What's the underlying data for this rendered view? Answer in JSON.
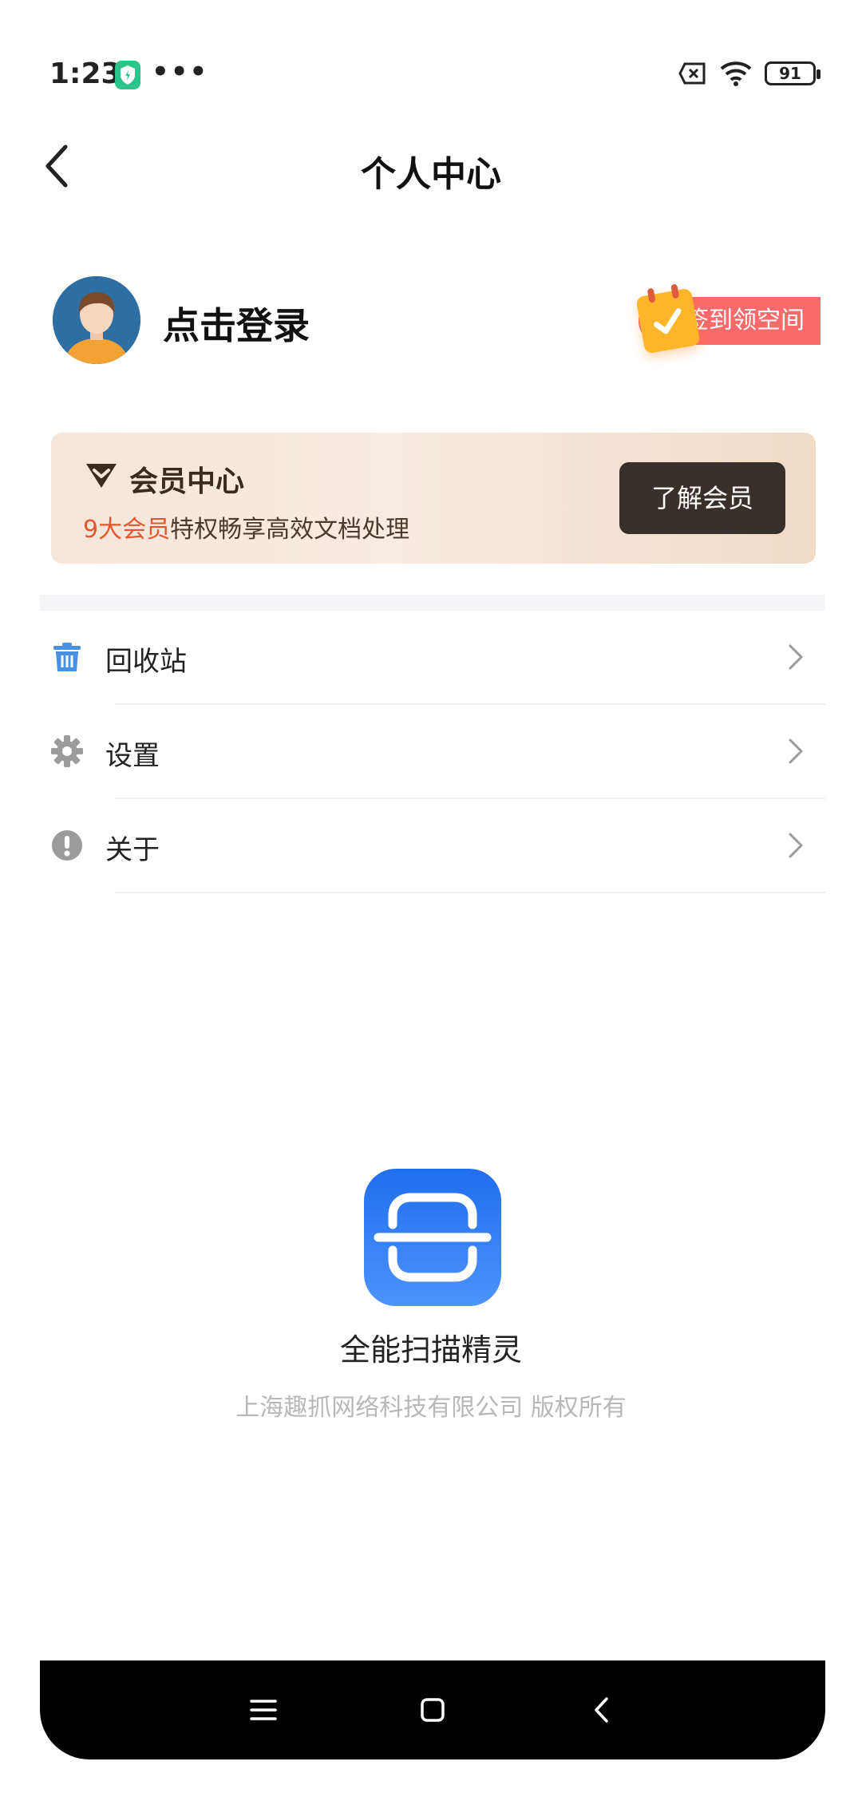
{
  "status_bar": {
    "time": "1:23",
    "dots": "•••",
    "battery": "91"
  },
  "header": {
    "title": "个人中心"
  },
  "profile": {
    "login_text": "点击登录",
    "checkin_label": "签到领空间"
  },
  "vip": {
    "title": "会员中心",
    "subtitle_highlight": "9大会员",
    "subtitle_rest": "特权畅享高效文档处理",
    "button": "了解会员"
  },
  "menu": [
    {
      "label": "回收站",
      "icon": "trash-icon"
    },
    {
      "label": "设置",
      "icon": "gear-icon"
    },
    {
      "label": "关于",
      "icon": "info-icon"
    }
  ],
  "app": {
    "name": "全能扫描精灵",
    "copyright": "上海趣抓网络科技有限公司  版权所有"
  },
  "colors": {
    "accent": "#2d7bf5",
    "vip_button": "#3a302a",
    "checkin": "#fb6a6a",
    "highlight": "#e4572e"
  }
}
